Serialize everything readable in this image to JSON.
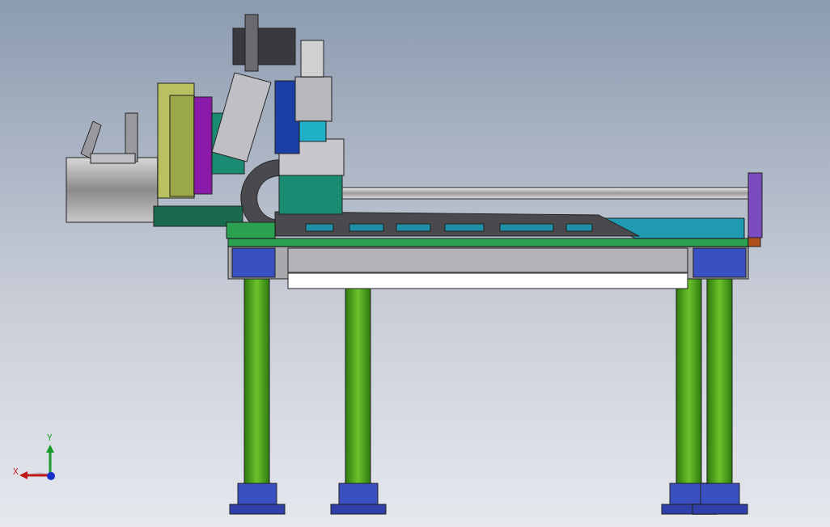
{
  "viewport": {
    "axis_triad": {
      "labels": [
        {
          "kind": "vertical",
          "text": "Y"
        },
        {
          "kind": "horizontal",
          "text": "X"
        }
      ]
    }
  }
}
